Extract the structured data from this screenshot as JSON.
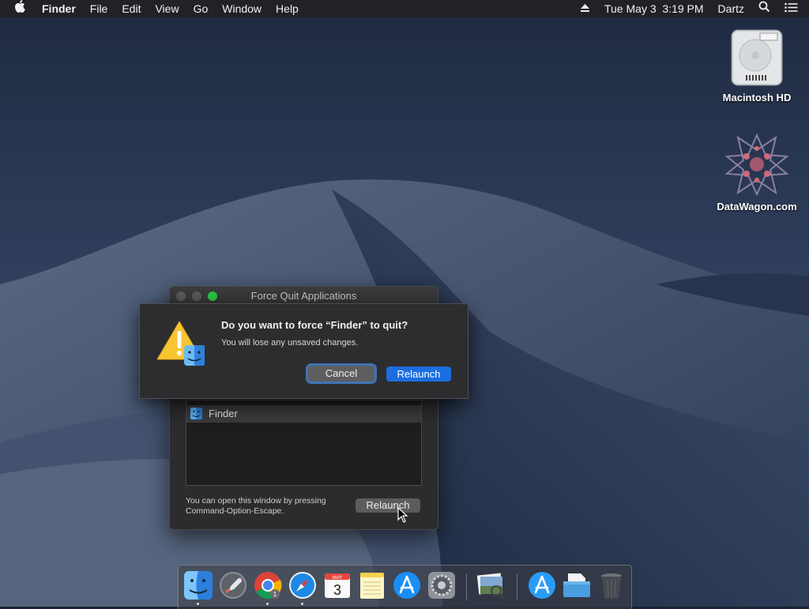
{
  "menubar": {
    "app_name": "Finder",
    "menus": [
      "File",
      "Edit",
      "View",
      "Go",
      "Window",
      "Help"
    ],
    "clock": "Tue May 3  3:19 PM",
    "user": "Dartz"
  },
  "desktop": {
    "icons": [
      {
        "label": "Macintosh HD"
      },
      {
        "label": "DataWagon.com"
      }
    ]
  },
  "force_quit": {
    "title": "Force Quit Applications",
    "list": [
      {
        "name": "Finder",
        "selected": true
      }
    ],
    "hint_line1": "You can open this window by pressing",
    "hint_line2": "Command-Option-Escape.",
    "relaunch_label": "Relaunch"
  },
  "alert": {
    "title": "Do you want to force “Finder” to quit?",
    "message": "You will lose any unsaved changes.",
    "cancel_label": "Cancel",
    "confirm_label": "Relaunch"
  },
  "dock": {
    "items": [
      {
        "icon": "finder-icon",
        "running": true
      },
      {
        "icon": "launchpad-icon",
        "running": false
      },
      {
        "icon": "chrome-icon",
        "running": true,
        "badge": "1"
      },
      {
        "icon": "safari-icon",
        "running": true
      },
      {
        "icon": "calendar-icon",
        "running": false,
        "month": "MAY",
        "day": "3"
      },
      {
        "icon": "notes-icon",
        "running": false
      },
      {
        "icon": "app-store-icon",
        "running": false
      },
      {
        "icon": "system-preferences-icon",
        "running": false
      },
      {
        "icon": "preview-icon",
        "running": false
      },
      {
        "icon": "applications-folder-icon",
        "running": false
      },
      {
        "icon": "downloads-folder-icon",
        "running": false
      },
      {
        "icon": "trash-icon",
        "running": false
      }
    ]
  },
  "colors": {
    "accent": "#1b6ee0",
    "close": "#5a5a5c",
    "zoom": "#2bc840"
  }
}
